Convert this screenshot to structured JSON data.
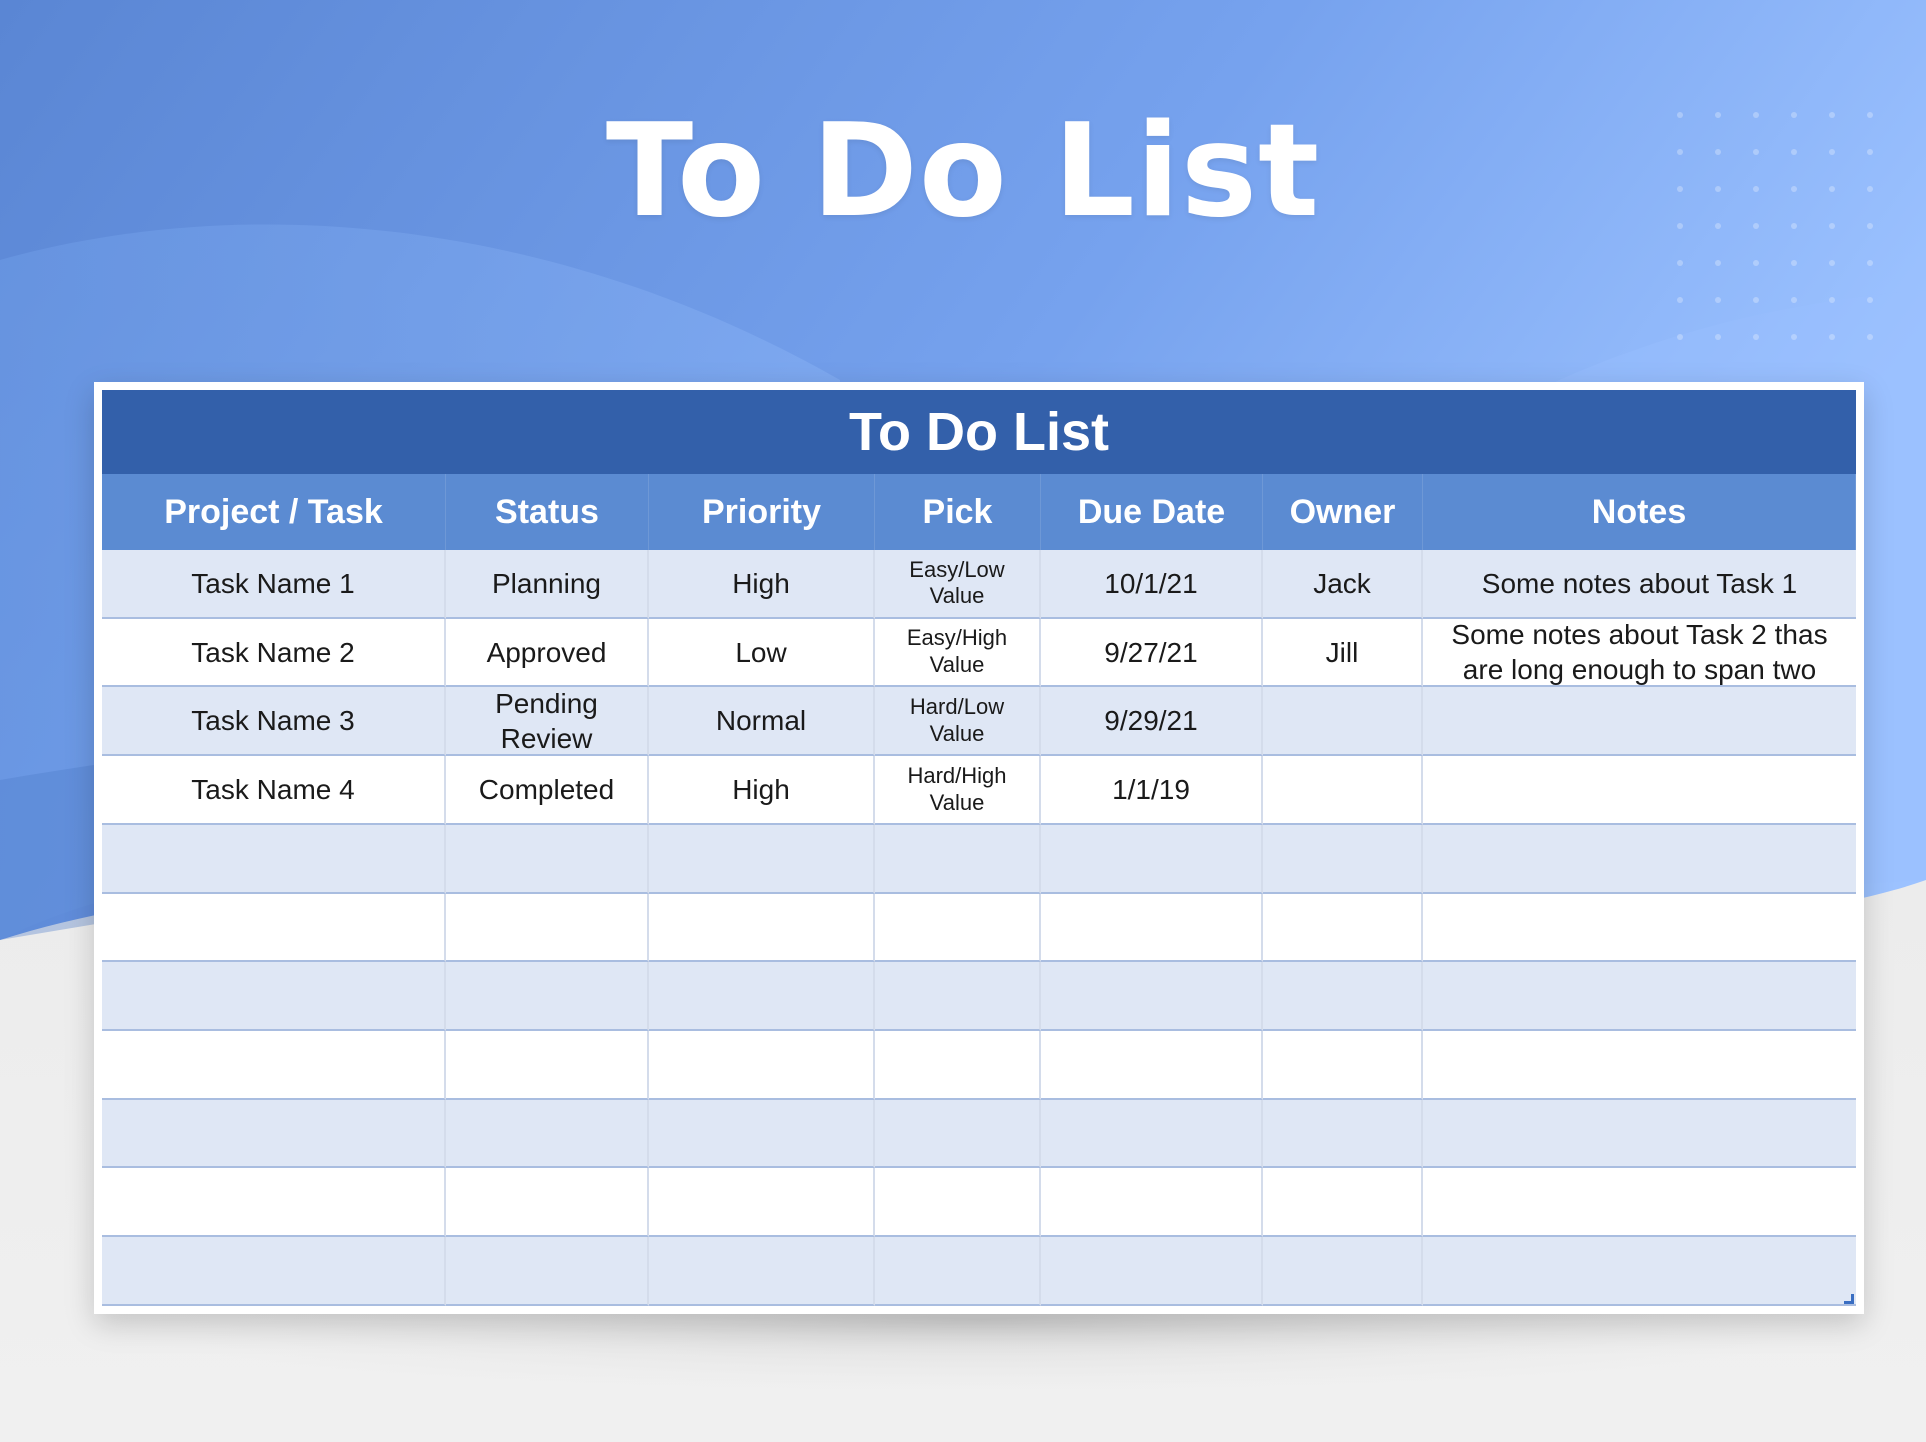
{
  "page": {
    "title": "To Do List"
  },
  "sheet": {
    "title": "To Do List",
    "columns": [
      "Project / Task",
      "Status",
      "Priority",
      "Pick",
      "Due Date",
      "Owner",
      "Notes"
    ],
    "rows": [
      [
        "Task Name 1",
        "Planning",
        "High",
        "Easy/Low Value",
        "10/1/21",
        "Jack",
        "Some notes about Task 1"
      ],
      [
        "Task Name 2",
        "Approved",
        "Low",
        "Easy/High Value",
        "9/27/21",
        "Jill",
        "Some notes about Task 2 thas are long enough to span two"
      ],
      [
        "Task Name 3",
        "Pending Review",
        "Normal",
        "Hard/Low Value",
        "9/29/21",
        "",
        ""
      ],
      [
        "Task Name 4",
        "Completed",
        "High",
        "Hard/High Value",
        "1/1/19",
        "",
        ""
      ],
      [
        "",
        "",
        "",
        "",
        "",
        "",
        ""
      ],
      [
        "",
        "",
        "",
        "",
        "",
        "",
        ""
      ],
      [
        "",
        "",
        "",
        "",
        "",
        "",
        ""
      ],
      [
        "",
        "",
        "",
        "",
        "",
        "",
        ""
      ],
      [
        "",
        "",
        "",
        "",
        "",
        "",
        ""
      ],
      [
        "",
        "",
        "",
        "",
        "",
        "",
        ""
      ],
      [
        "",
        "",
        "",
        "",
        "",
        "",
        ""
      ]
    ]
  },
  "colors": {
    "title_bar": "#3360aa",
    "header_bar": "#5b8bd2",
    "band_row": "#dfe7f5",
    "background_blue": "#6e9be6"
  }
}
